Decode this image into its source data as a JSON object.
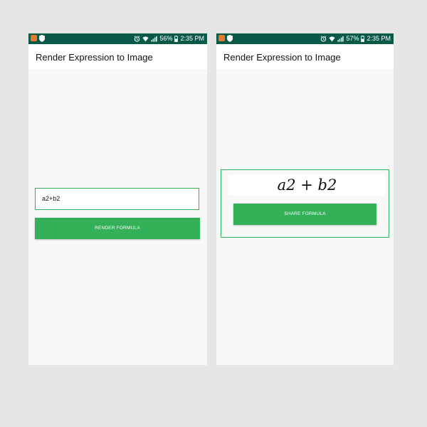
{
  "colors": {
    "status_bar": "#0b5a49",
    "accent_green": "#34b059",
    "background": "#f8f8f8",
    "page_background": "#e6e6e6"
  },
  "left_screen": {
    "status_bar": {
      "battery_percent": "56%",
      "time": "2:35 PM"
    },
    "app_title": "Render Expression to Image",
    "input": {
      "value": "a2+b2"
    },
    "render_button_label": "RENDER FORMULA"
  },
  "right_screen": {
    "status_bar": {
      "battery_percent": "57%",
      "time": "2:35 PM"
    },
    "app_title": "Render Expression to Image",
    "rendered_formula": "a2 + b2",
    "share_button_label": "SHARE FORMULA"
  },
  "icons": [
    "app-notification-icon",
    "shield-icon",
    "alarm-icon",
    "wifi-icon",
    "signal-icon",
    "battery-icon"
  ]
}
